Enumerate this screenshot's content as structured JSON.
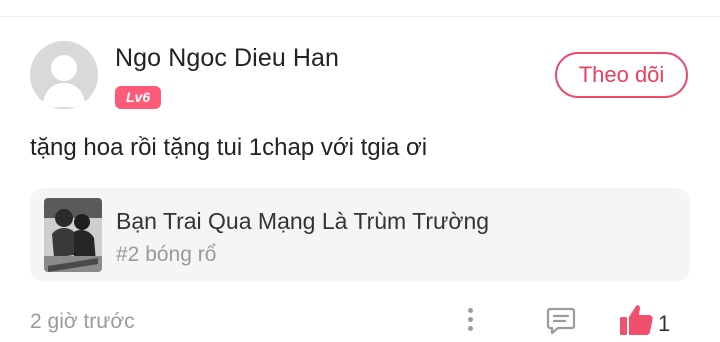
{
  "comment": {
    "author": {
      "name": "Ngo Ngoc Dieu Han",
      "level": "Lv6"
    },
    "follow_label": "Theo dõi",
    "text": "tặng hoa rồi tặng tui 1chap với tgia ơi",
    "story": {
      "title": "Bạn Trai Qua Mạng Là Trùm Trường",
      "chapter": "#2 bóng rổ"
    },
    "timestamp": "2 giờ trước",
    "like_count": "1",
    "icons": {
      "more": "more-vertical-icon",
      "reply": "comment-icon",
      "like": "thumbs-up-icon"
    },
    "colors": {
      "accent": "#ef4a6a",
      "badge": "#ff5a78"
    }
  }
}
